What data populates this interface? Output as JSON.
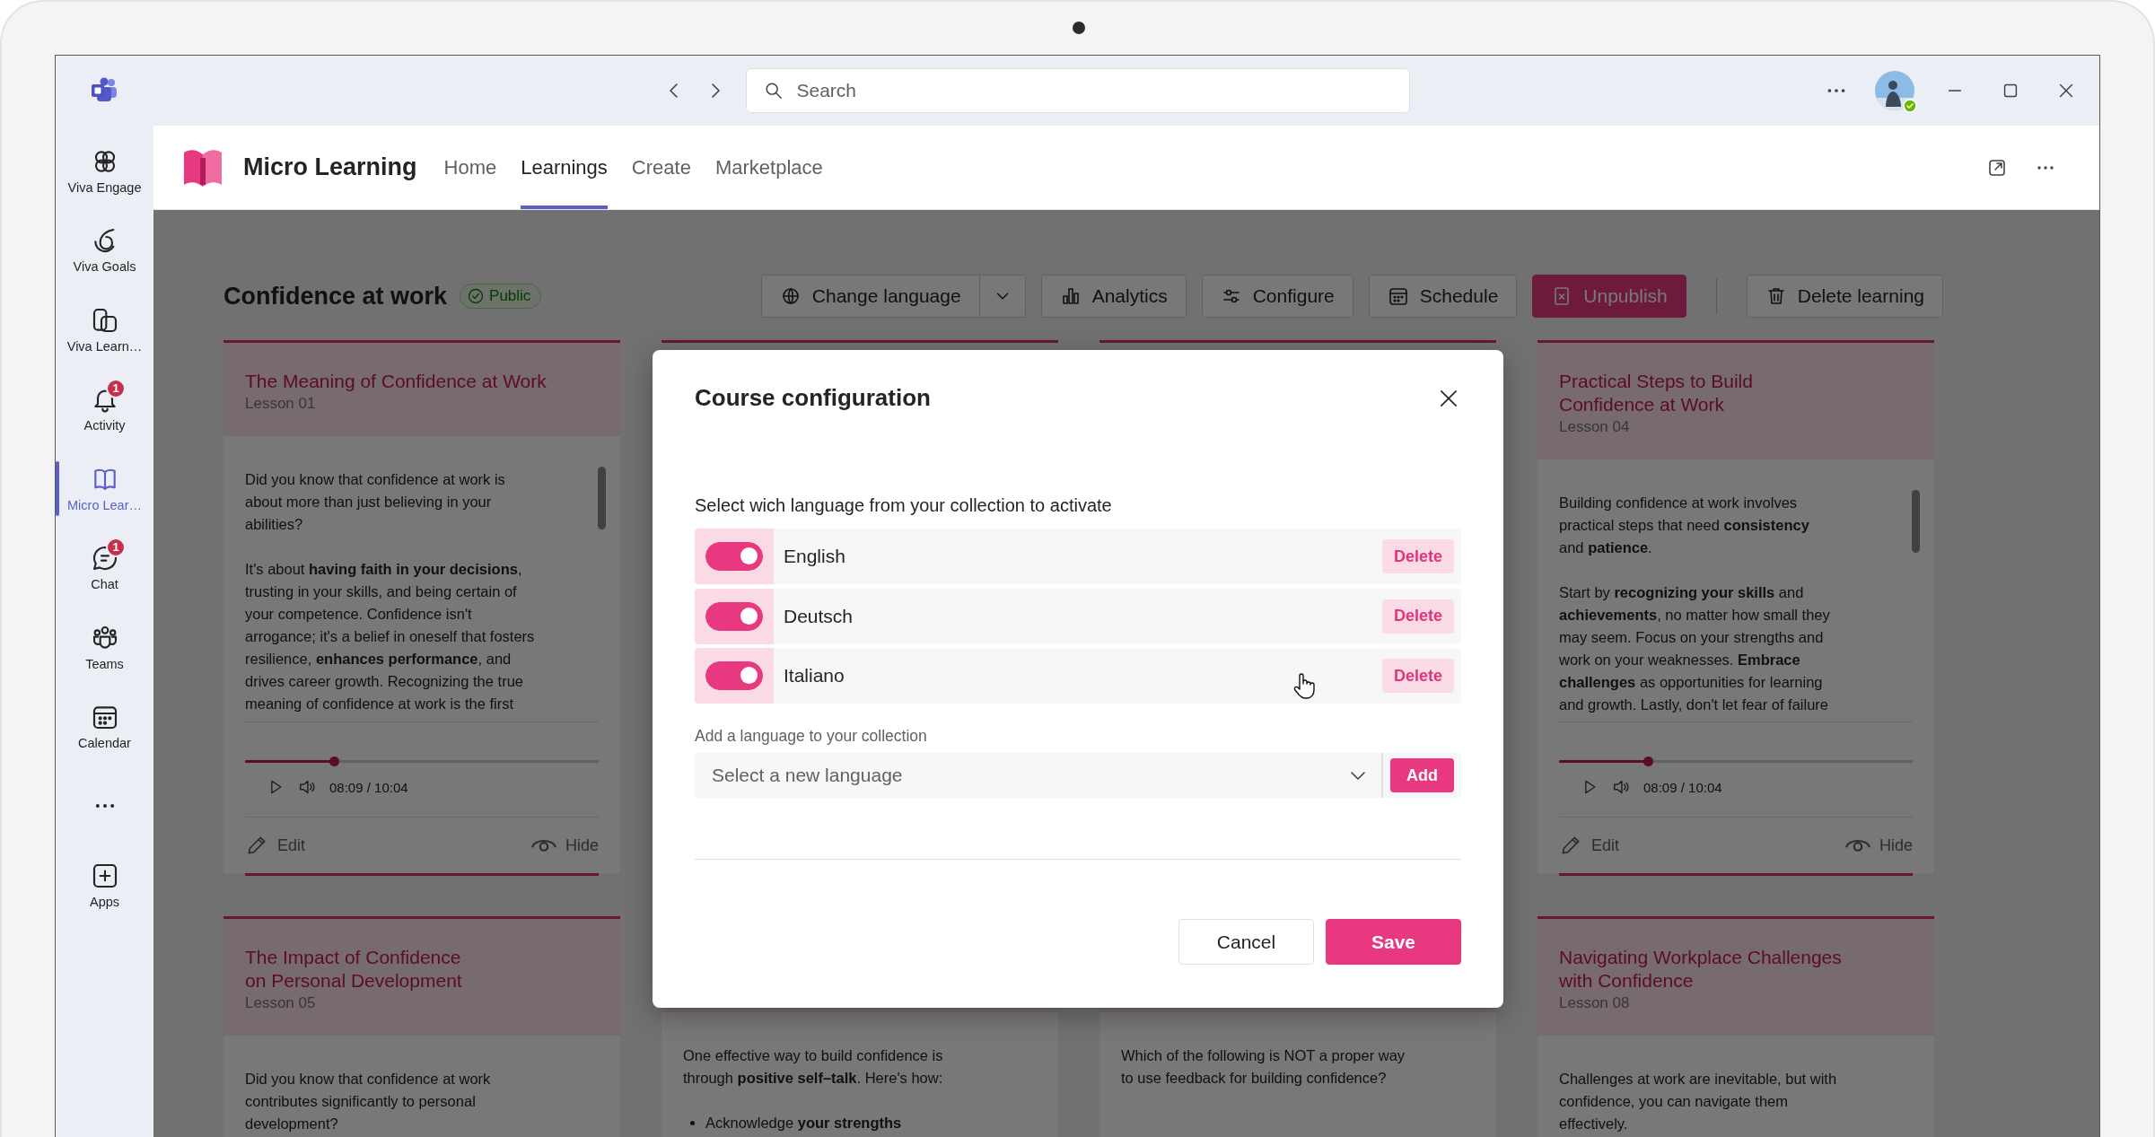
{
  "titlebar": {
    "search_placeholder": "Search"
  },
  "rail": [
    {
      "kind": "app",
      "label": "Viva Engage",
      "selected": false
    },
    {
      "kind": "app",
      "label": "Viva Goals",
      "selected": false
    },
    {
      "kind": "app",
      "label": "Viva Learn…",
      "selected": false
    },
    {
      "kind": "app",
      "label": "Activity",
      "selected": false,
      "badge": "1"
    },
    {
      "kind": "app",
      "label": "Micro Lear…",
      "selected": true
    },
    {
      "kind": "app",
      "label": "Chat",
      "selected": false,
      "badge": "1"
    },
    {
      "kind": "app",
      "label": "Teams",
      "selected": false
    },
    {
      "kind": "app",
      "label": "Calendar",
      "selected": false
    },
    {
      "kind": "more"
    },
    {
      "kind": "app",
      "label": "Apps",
      "selected": false
    }
  ],
  "app": {
    "name": "Micro Learning",
    "tabs": [
      {
        "label": "Home",
        "selected": false
      },
      {
        "label": "Learnings",
        "selected": true
      },
      {
        "label": "Create",
        "selected": false
      },
      {
        "label": "Marketplace",
        "selected": false
      }
    ]
  },
  "learning": {
    "title": "Confidence at work",
    "status": "Public",
    "actions": [
      {
        "label": "Change language",
        "kind": "split"
      },
      {
        "label": "Analytics",
        "kind": "default"
      },
      {
        "label": "Configure",
        "kind": "default"
      },
      {
        "label": "Schedule",
        "kind": "default"
      },
      {
        "label": "Unpublish",
        "kind": "primary"
      },
      {
        "label": "Delete learning",
        "kind": "separated"
      }
    ]
  },
  "cards": [
    {
      "kind": "lesson",
      "title": "The Meaning of Confidence at Work",
      "lesson": "Lesson 01",
      "paragraphs": [
        "Did you know that confidence at work is\nabout more than just believing in your\nabilities?",
        "It's about **having faith in your decisions**,\ntrusting in your skills, and being certain of\nyour competence. Confidence isn't\narrogance; it's a belief in oneself that fosters\nresilience, **enhances performance**, and\ndrives career growth. Recognizing the true\nmeaning of confidence at work is the first"
      ],
      "level": 0.25,
      "time": "08:09 / 10:04",
      "edit": "Edit",
      "hide": "Hide"
    },
    {
      "kind": "covered"
    },
    {
      "kind": "covered"
    },
    {
      "kind": "lesson",
      "title": "Practical Steps to Build\nConfidence at Work",
      "lesson": "Lesson 04",
      "paragraphs": [
        "Building confidence at work involves\npractical steps that need **consistency**\nand **patience**.",
        "Start by **recognizing your skills** and\n**achievements**, no matter how small they\nmay seem. Focus on your strengths and\nwork on your weaknesses. **Embrace**\n**challenges** as opportunities for learning\nand growth. Lastly, don't let fear of failure"
      ],
      "level": 0.25,
      "time": "08:09 / 10:04",
      "edit": "Edit",
      "hide": "Hide"
    },
    {
      "kind": "lesson",
      "title": "The Impact of Confidence\non Personal Development",
      "lesson": "Lesson 05",
      "paragraphs": [
        "Did you know that confidence at work\ncontributes significantly to personal\ndevelopment?"
      ]
    },
    {
      "kind": "lesson",
      "paragraphs": [
        "One effective way to build confidence is\nthrough **positive self–talk**. Here's how:"
      ],
      "bullets": [
        "Acknowledge **your strengths**"
      ]
    },
    {
      "kind": "lesson",
      "paragraphs": [
        "Which of the following is NOT a proper way\nto use feedback for building confidence?"
      ]
    },
    {
      "kind": "lesson",
      "title": "Navigating Workplace Challenges\nwith Confidence",
      "lesson": "Lesson 08",
      "paragraphs": [
        "Challenges at work are inevitable, but with\nconfidence, you can navigate them\neffectively."
      ]
    }
  ],
  "dialog": {
    "title": "Course configuration",
    "prompt": "Select wich language from your collection to activate",
    "languages": [
      {
        "name": "English",
        "on": true,
        "action": "Delete"
      },
      {
        "name": "Deutsch",
        "on": true,
        "action": "Delete"
      },
      {
        "name": "Italiano",
        "on": true,
        "action": "Delete"
      }
    ],
    "add_label": "Add a language to your collection",
    "select_placeholder": "Select a new language",
    "add_button": "Add",
    "buttons": [
      "Cancel",
      "Save"
    ]
  }
}
